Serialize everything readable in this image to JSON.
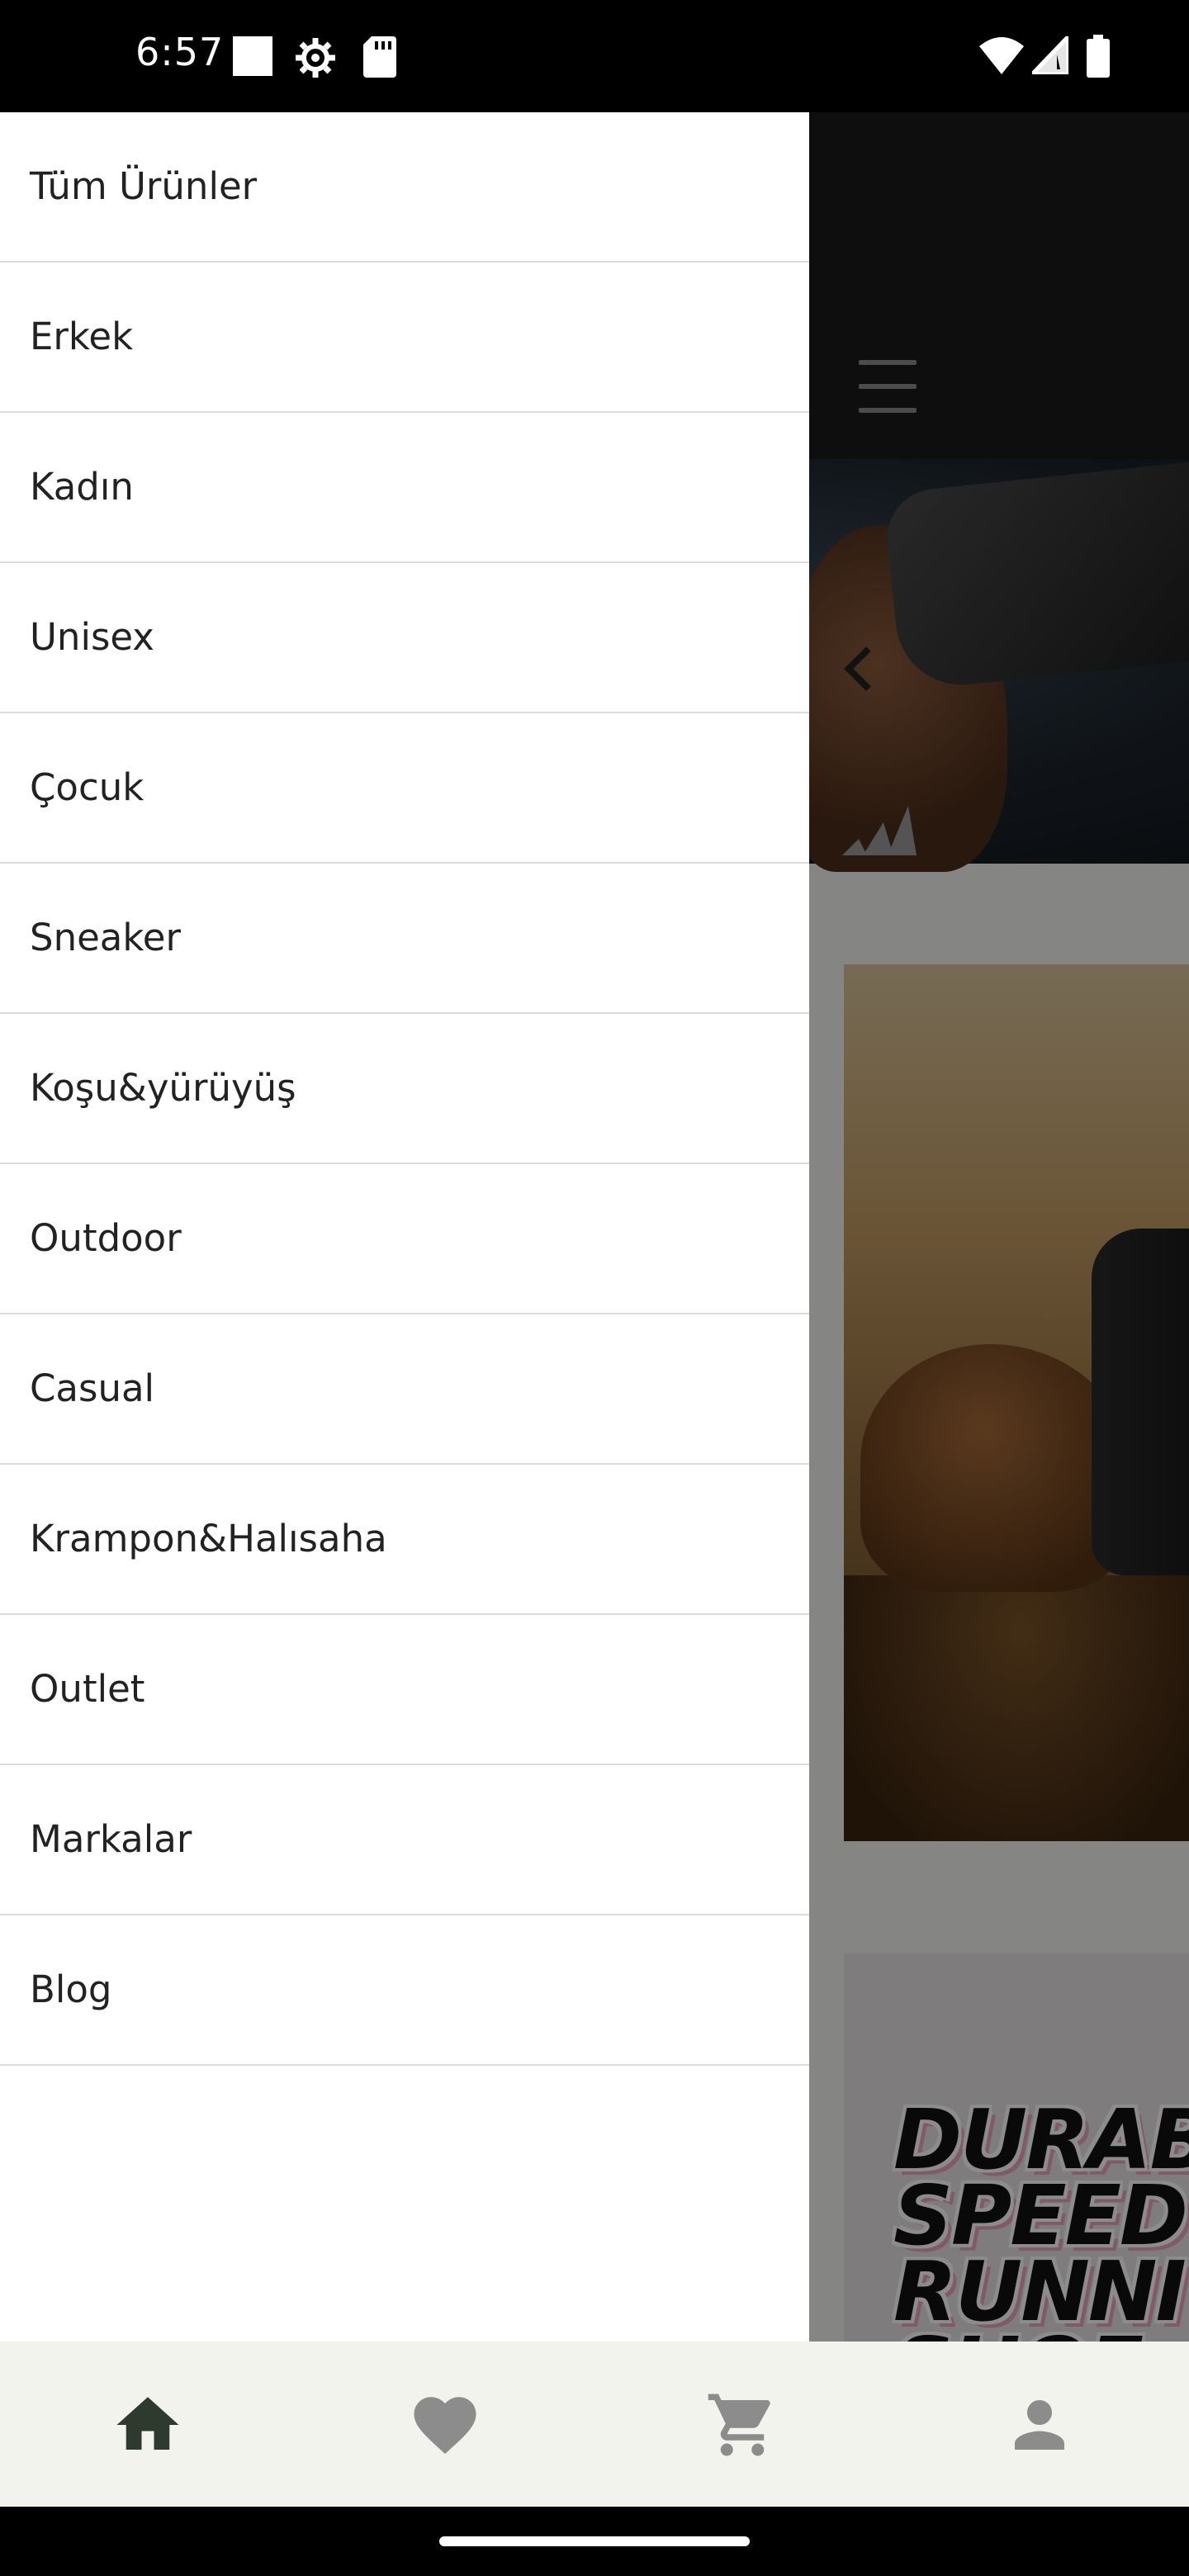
{
  "status_bar": {
    "time": "6:57"
  },
  "drawer": {
    "items": [
      {
        "label": "Tüm Ürünler"
      },
      {
        "label": "Erkek"
      },
      {
        "label": "Kadın"
      },
      {
        "label": "Unisex"
      },
      {
        "label": "Çocuk"
      },
      {
        "label": "Sneaker"
      },
      {
        "label": "Koşu&yürüyüş"
      },
      {
        "label": "Outdoor"
      },
      {
        "label": "Casual"
      },
      {
        "label": "Krampon&Halısaha"
      },
      {
        "label": "Outlet"
      },
      {
        "label": "Markalar"
      },
      {
        "label": "Blog"
      }
    ]
  },
  "background": {
    "promo_text": "DURAB\nSPEED\nRUNNI\nSHOE"
  },
  "bottom_nav": {
    "items": [
      {
        "icon": "home-icon"
      },
      {
        "icon": "heart-icon"
      },
      {
        "icon": "cart-icon"
      },
      {
        "icon": "profile-icon"
      }
    ]
  },
  "colors": {
    "drawer_bg": "#ffffff",
    "header_bg": "#1a1a1a",
    "nav_bg": "#f3f3ee",
    "nav_active": "#2f3a2f",
    "nav_inactive": "#8c8c8c"
  }
}
